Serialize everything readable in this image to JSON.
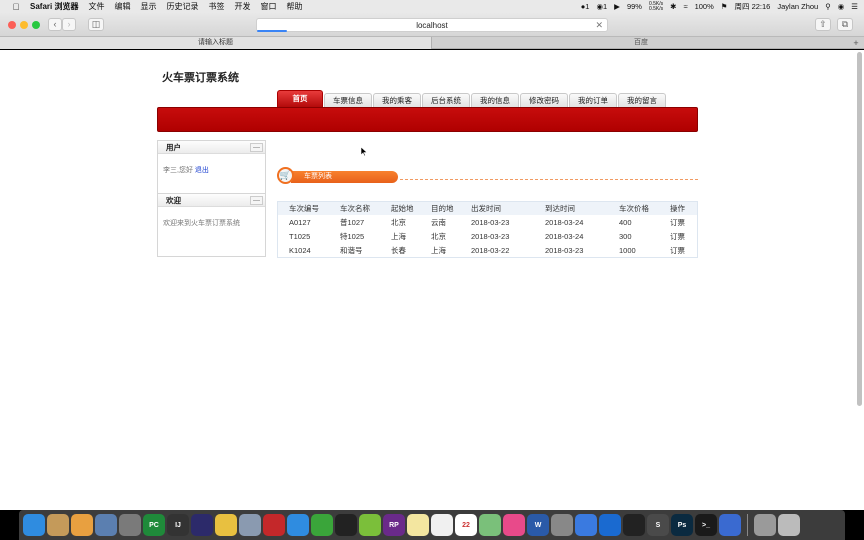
{
  "menubar": {
    "apple": "",
    "app_name": "Safari 浏览器",
    "items": [
      "文件",
      "编辑",
      "显示",
      "历史记录",
      "书签",
      "开发",
      "窗口",
      "帮助"
    ],
    "status": {
      "qq_count": "1",
      "wechat_count": "1",
      "battery_pct": "99%",
      "net_up": "0.5K/s",
      "net_down": "0.5K/s",
      "battery2": "100%",
      "clock": "周四 22:16",
      "user": "Jaylan Zhou"
    }
  },
  "browser": {
    "address": "localhost",
    "tabs": [
      {
        "label": "请输入标题",
        "active": true
      },
      {
        "label": "百度",
        "active": false
      }
    ],
    "new_tab": "+"
  },
  "site": {
    "title": "火车票订票系统",
    "nav": [
      {
        "label": "首页",
        "active": true,
        "width": 46
      },
      {
        "label": "车票信息",
        "active": false,
        "width": 48
      },
      {
        "label": "我的乘客",
        "active": false,
        "width": 48
      },
      {
        "label": "后台系统",
        "active": false,
        "width": 48
      },
      {
        "label": "我的信息",
        "active": false,
        "width": 48
      },
      {
        "label": "修改密码",
        "active": false,
        "width": 48
      },
      {
        "label": "我的订单",
        "active": false,
        "width": 48
      },
      {
        "label": "我的留言",
        "active": false,
        "width": 48
      }
    ]
  },
  "user_panel": {
    "title": "用户",
    "greeting": "李三,您好",
    "logout": "退出",
    "collapse": "—"
  },
  "welcome_panel": {
    "title": "欢迎",
    "text": "欢迎来到火车票订票系统",
    "collapse": "—"
  },
  "ticket_section": {
    "title": "车票列表",
    "columns": [
      "车次编号",
      "车次名称",
      "起始地",
      "目的地",
      "出发时间",
      "到达时间",
      "车次价格",
      "操作"
    ],
    "rows": [
      [
        "A0127",
        "普1027",
        "北京",
        "云南",
        "2018-03-23",
        "2018-03-24",
        "400",
        "订票"
      ],
      [
        "T1025",
        "特1025",
        "上海",
        "北京",
        "2018-03-23",
        "2018-03-24",
        "300",
        "订票"
      ],
      [
        "K1024",
        "和谐号",
        "长春",
        "上海",
        "2018-03-22",
        "2018-03-23",
        "1000",
        "订票"
      ]
    ]
  },
  "dock": {
    "apps": [
      {
        "name": "finder",
        "color": "#2f8ce0",
        "label": ""
      },
      {
        "name": "notes-app",
        "color": "#c49a5a",
        "label": ""
      },
      {
        "name": "photos",
        "color": "#e8a040",
        "label": ""
      },
      {
        "name": "preview",
        "color": "#5b7fb0",
        "label": ""
      },
      {
        "name": "launchpad",
        "color": "#7a7a7a",
        "label": ""
      },
      {
        "name": "pycharm",
        "color": "#1f8a3a",
        "label": "PC"
      },
      {
        "name": "intellij",
        "color": "#333333",
        "label": "IJ"
      },
      {
        "name": "eclipse",
        "color": "#2c2a6a",
        "label": ""
      },
      {
        "name": "sequel",
        "color": "#e8c040",
        "label": ""
      },
      {
        "name": "database",
        "color": "#8a9ab0",
        "label": ""
      },
      {
        "name": "redis",
        "color": "#c4282a",
        "label": ""
      },
      {
        "name": "safari",
        "color": "#2f8ce0",
        "label": ""
      },
      {
        "name": "wechat",
        "color": "#3aa53a",
        "label": ""
      },
      {
        "name": "qq",
        "color": "#222222",
        "label": ""
      },
      {
        "name": "elephant",
        "color": "#7bbf3a",
        "label": ""
      },
      {
        "name": "axure",
        "color": "#6a2a8a",
        "label": "RP"
      },
      {
        "name": "notes",
        "color": "#f3e6a0",
        "label": ""
      },
      {
        "name": "textedit",
        "color": "#f0f0f0",
        "label": ""
      },
      {
        "name": "calendar",
        "color": "#ffffff",
        "label": "22"
      },
      {
        "name": "maps",
        "color": "#7ac07a",
        "label": ""
      },
      {
        "name": "itunes",
        "color": "#e84a8a",
        "label": ""
      },
      {
        "name": "word",
        "color": "#2a5aa8",
        "label": "W"
      },
      {
        "name": "system-prefs",
        "color": "#888888",
        "label": ""
      },
      {
        "name": "baidu-netdisk",
        "color": "#3a7ae0",
        "label": ""
      },
      {
        "name": "teamviewer",
        "color": "#1a6ad0",
        "label": ""
      },
      {
        "name": "qq-alt",
        "color": "#222222",
        "label": ""
      },
      {
        "name": "sublime",
        "color": "#4a4a4a",
        "label": "S"
      },
      {
        "name": "photoshop",
        "color": "#0a2a40",
        "label": "Ps"
      },
      {
        "name": "terminal",
        "color": "#1a1a1a",
        "label": ">_"
      },
      {
        "name": "chrome-beta",
        "color": "#3a6ad0",
        "label": ""
      }
    ],
    "trailing": [
      {
        "name": "downloads",
        "color": "#9a9a9a",
        "label": ""
      },
      {
        "name": "trash",
        "color": "#bbbbbb",
        "label": ""
      }
    ]
  }
}
